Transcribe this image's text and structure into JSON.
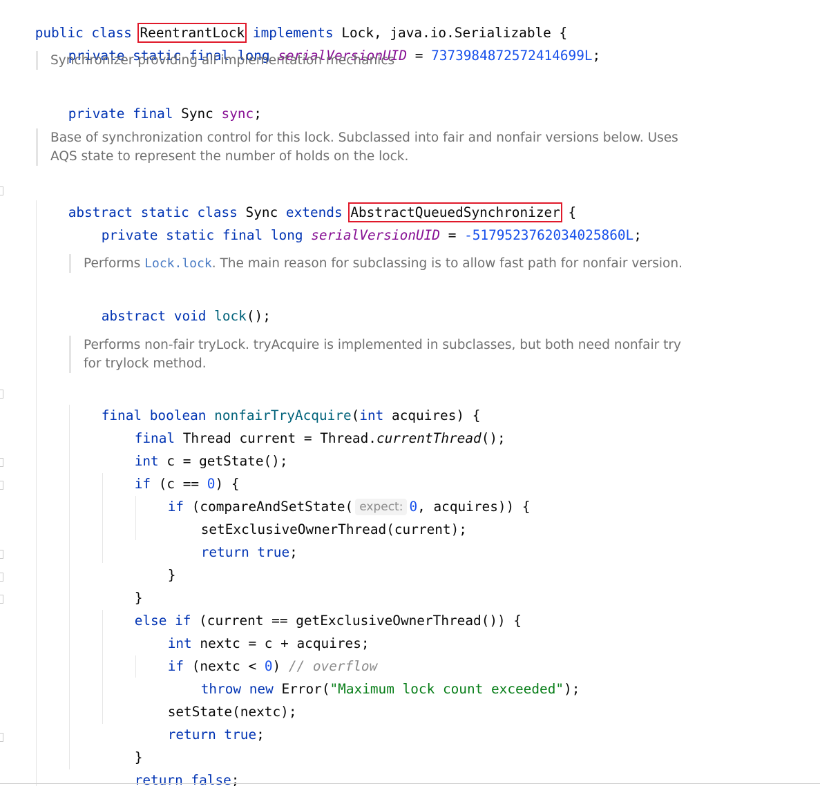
{
  "code": {
    "l1": {
      "t1": "public class ",
      "t2": "ReentrantLock",
      "t3": " implements ",
      "t4": "Lock, java.io.Serializable {"
    },
    "l2": {
      "t1": "private static final long ",
      "t2": "serialVersionUID",
      "t3": " = ",
      "t4": "7373984872572414699L",
      "t5": ";"
    },
    "doc1": {
      "line1": "Synchronizer providing all implementation mechanics"
    },
    "l3": {
      "t1": "private final ",
      "t2": "Sync ",
      "t3": "sync",
      "t4": ";"
    },
    "doc2": {
      "line1": "Base of synchronization control for this lock. Subclassed into fair and nonfair versions below. Uses",
      "line2": "AQS state to represent the number of holds on the lock."
    },
    "l4": {
      "t1": "abstract static class ",
      "t2": "Sync ",
      "t3": "extends ",
      "t4": "AbstractQueuedSynchronizer",
      "t5": " {"
    },
    "l5": {
      "t1": "private static final long ",
      "t2": "serialVersionUID",
      "t3": " = ",
      "t4": "-5179523762034025860L",
      "t5": ";"
    },
    "doc3": {
      "pre": "Performs ",
      "code": "Lock.lock",
      "post": ". The main reason for subclassing is to allow fast path for nonfair version."
    },
    "l6": {
      "t1": "abstract void ",
      "t2": "lock",
      "t3": "();"
    },
    "doc4": {
      "line1": "Performs non-fair tryLock. tryAcquire is implemented in subclasses, but both need nonfair try",
      "line2": "for trylock method."
    },
    "l7": {
      "t1": "final boolean ",
      "t2": "nonfairTryAcquire",
      "t3": "(",
      "t4": "int ",
      "t5": "acquires) {"
    },
    "l8": {
      "t1": "final ",
      "t2": "Thread current = Thread.",
      "t3": "currentThread",
      "t4": "();"
    },
    "l9": {
      "t1": "int ",
      "t2": "c = getState();"
    },
    "l10": {
      "t1": "if ",
      "t2": "(c == ",
      "t3": "0",
      "t4": ") {"
    },
    "l11": {
      "t1": "if ",
      "t2": "(compareAndSetState(",
      "hint": "expect:",
      "t3": "0",
      "t4": ", acquires)) {"
    },
    "l12": {
      "t1": "setExclusiveOwnerThread(current);"
    },
    "l13": {
      "t1": "return true",
      "t2": ";"
    },
    "l14": {
      "t1": "}"
    },
    "l15": {
      "t1": "}"
    },
    "l16": {
      "t1": "else if ",
      "t2": "(current == getExclusiveOwnerThread()) {"
    },
    "l17": {
      "t1": "int ",
      "t2": "nextc = c + acquires;"
    },
    "l18": {
      "t1": "if ",
      "t2": "(nextc < ",
      "t3": "0",
      "t4": ") ",
      "t5": "// overflow"
    },
    "l19": {
      "t1": "throw new ",
      "t2": "Error(",
      "t3": "\"Maximum lock count exceeded\"",
      "t4": ");"
    },
    "l20": {
      "t1": "setState(nextc);"
    },
    "l21": {
      "t1": "return true",
      "t2": ";"
    },
    "l22": {
      "t1": "}"
    },
    "l23": {
      "t1": "return false",
      "t2": ";"
    },
    "l24": {
      "t1": "}"
    }
  },
  "colors": {
    "keyword": "#0033b3",
    "field": "#871094",
    "number": "#1750eb",
    "method": "#00627a",
    "string": "#067d17",
    "comment": "#8c8c8c",
    "highlight_box": "#e0192a"
  }
}
